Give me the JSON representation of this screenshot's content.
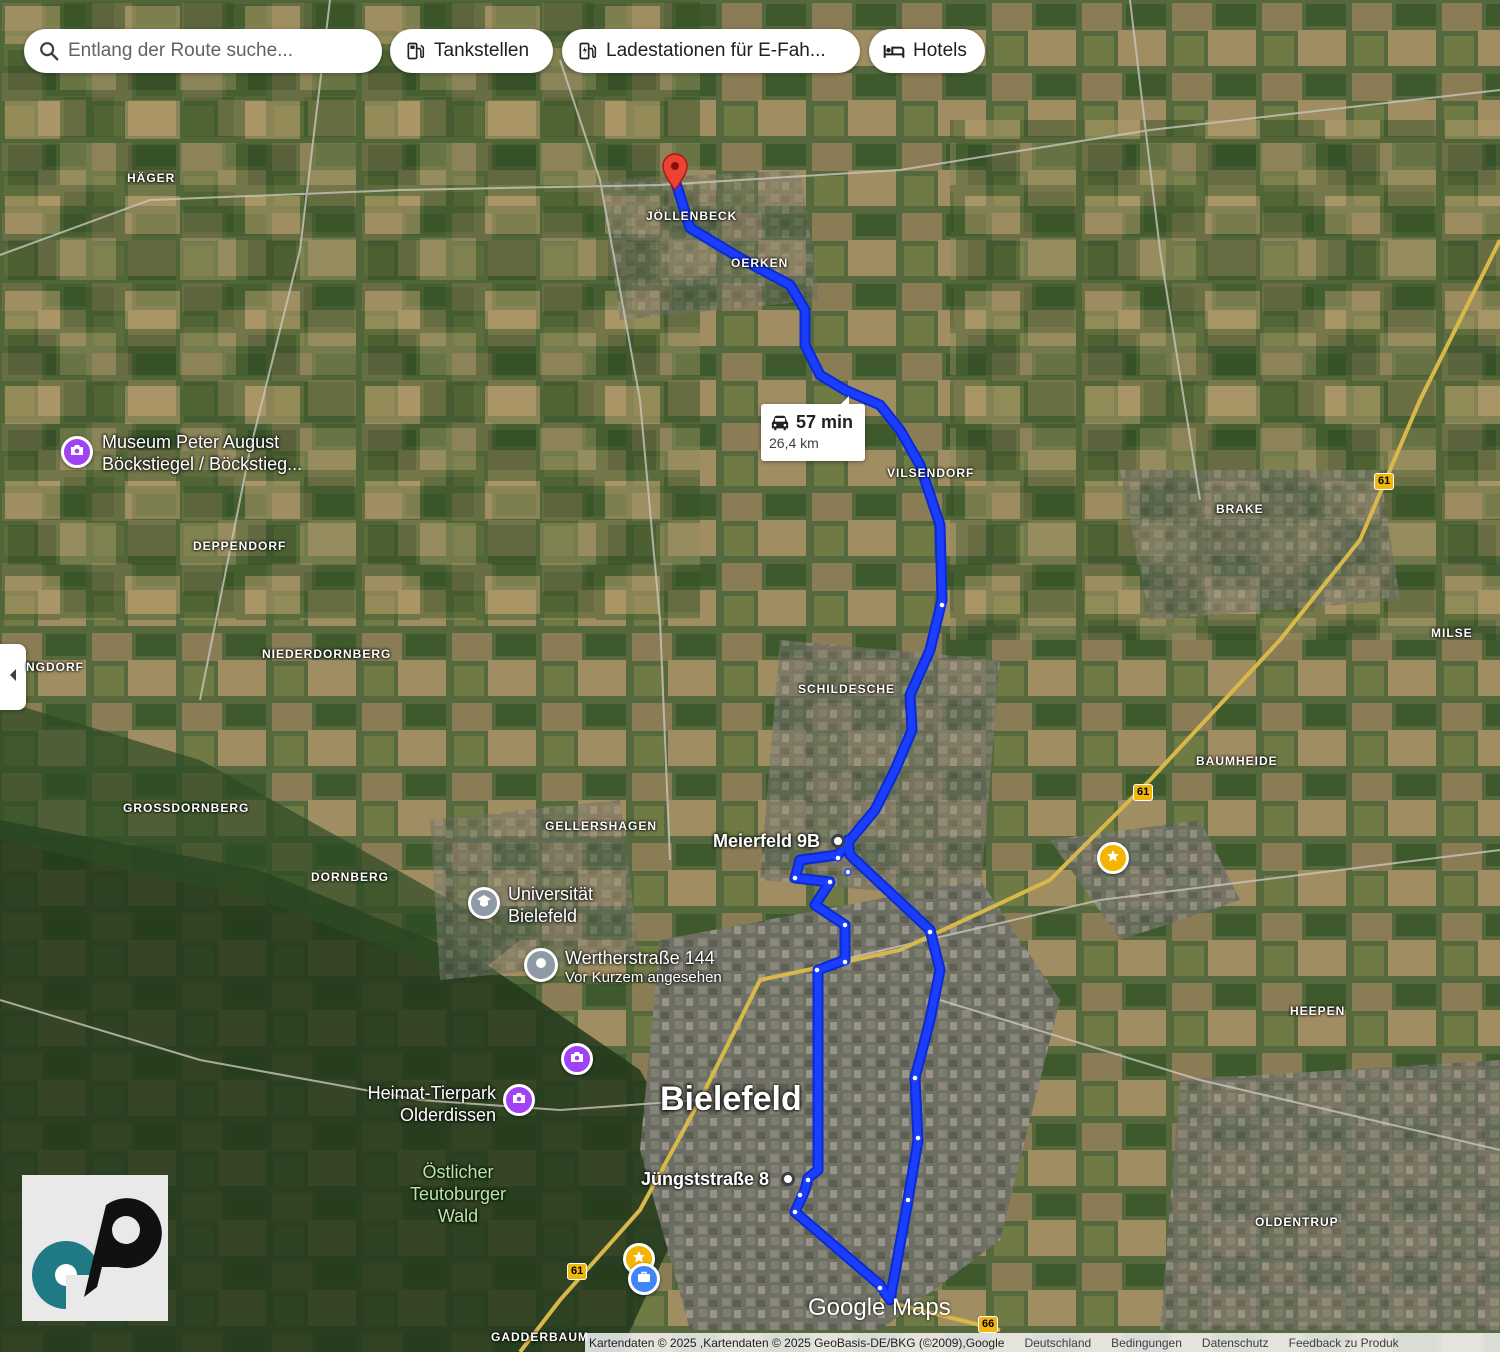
{
  "search": {
    "placeholder": "Entlang der Route suche..."
  },
  "chips": {
    "gas": "Tankstellen",
    "ev": "Ladestationen für E-Fah...",
    "hotels": "Hotels"
  },
  "route": {
    "duration": "57 min",
    "distance": "26,4 km",
    "color": "#1a3dff",
    "stops": {
      "meierfeld": "Meierfeld 9B",
      "jungst": "Jüngststraße 8"
    }
  },
  "districts": {
    "hager": "HÄGER",
    "jollenbeck": "JÖLLENBECK",
    "oerken": "OERKEN",
    "vilsendorf": "VILSENDORF",
    "brake": "BRAKE",
    "deppendorf": "DEPPENDORF",
    "milse": "MILSE",
    "ngdorf": "NGDORF",
    "niederdornberg": "NIEDERDORNBERG",
    "schildesche": "SCHILDESCHE",
    "baumheide": "BAUMHEIDE",
    "grossdornberg": "GROSSDORNBERG",
    "gellershagen": "GELLERSHAGEN",
    "dornberg": "DORNBERG",
    "heepen": "HEEPEN",
    "oldentrup": "OLDENTRUP",
    "gadderbaum": "GADDERBAUM"
  },
  "places": {
    "museum_line1": "Museum Peter August",
    "museum_line2": "Böckstiegel / Böckstieg...",
    "uni_line1": "Universität",
    "uni_line2": "Bielefeld",
    "werther_line1": "Wertherstraße 144",
    "werther_line2": "Vor Kurzem angesehen",
    "tierpark_line1": "Heimat-Tierpark",
    "tierpark_line2": "Olderdissen",
    "forest_line1": "Östlicher",
    "forest_line2": "Teutoburger",
    "forest_line3": "Wald",
    "city": "Bielefeld"
  },
  "shields": {
    "a61_top": "61",
    "a61_mid": "61",
    "a61_bottom": "61",
    "a66": "66"
  },
  "branding": {
    "google_maps": "Google Maps"
  },
  "footer": {
    "attribution": "Kartendaten © 2025 ,Kartendaten © 2025 GeoBasis-DE/BKG (©2009),Google",
    "country": "Deutschland",
    "terms": "Bedingungen",
    "privacy": "Datenschutz",
    "feedback": "Feedback zu Produk"
  },
  "colors": {
    "poi_purple": "#a142f4",
    "poi_gray": "#8e9aa6",
    "poi_gold": "#f5b400",
    "poi_blue": "#4285f4",
    "destination_red": "#ea4335"
  },
  "icons": [
    "search-icon",
    "gas-pump-icon",
    "ev-charger-icon",
    "bed-icon",
    "car-icon",
    "chevron-left-icon",
    "camera-icon",
    "school-icon",
    "star-icon",
    "briefcase-icon",
    "location-pin-icon"
  ]
}
